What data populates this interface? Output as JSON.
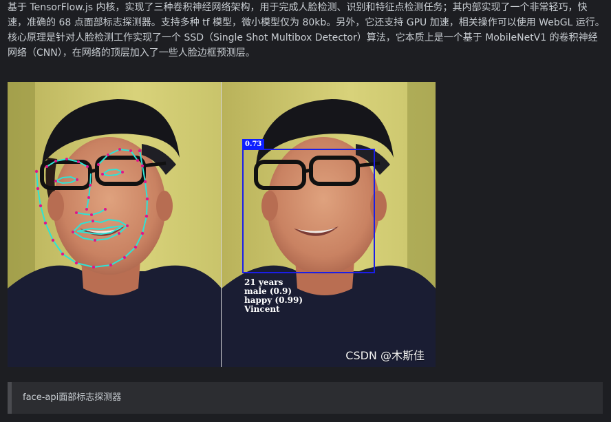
{
  "article": {
    "paragraph_1": "基于 TensorFlow.js 内核，实现了三种卷积神经网络架构，用于完成人脸检测、识别和特征点检测任务；其内部实现了一个非常轻巧，快速，准确的 68 点面部标志探测器。支持多种 tf 模型，微小模型仅为 80kb。另外，它还支持 GPU 加速，相关操作可以使用 WebGL 运行。",
    "paragraph_2": "核心原理是针对人脸检测工作实现了一个 SSD（Single Shot Multibox Detector）算法，它本质上是一个基于 MobileNetV1 的卷积神经网络（CNN），在网络的顶层加入了一些人脸边框预测层。"
  },
  "image": {
    "detection": {
      "confidence": "0.73",
      "age": "21 years",
      "gender": "male (0.9)",
      "expression": "happy (0.99)",
      "name": "Vincent"
    },
    "watermark": "CSDN @木斯佳"
  },
  "caption": {
    "text": "face-api面部标志探测器"
  },
  "colors": {
    "page_background": "#1d1e22",
    "text": "#c9ced3",
    "caption_background": "#2c2d31",
    "caption_border": "#4a4b50",
    "box_blue": "#1a1ee8",
    "badge_blue": "#0d1fff",
    "landmark_line": "#2ee3d6",
    "landmark_point": "#e0158a"
  }
}
